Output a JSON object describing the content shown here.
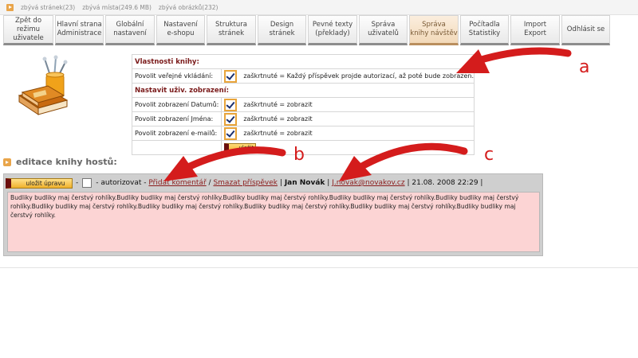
{
  "statusbar": {
    "items": [
      "zbývá stránek(23)",
      "zbývá místa(249.6 MB)",
      "zbývá obrázků(232)"
    ]
  },
  "nav": {
    "tabs": [
      {
        "label": "Zpět do režimu\nuživatele"
      },
      {
        "label": "Hlavní strana\nAdministrace"
      },
      {
        "label": "Globální\nnastavení"
      },
      {
        "label": "Nastavení\ne-shopu"
      },
      {
        "label": "Struktura\nstránek"
      },
      {
        "label": "Design\nstránek"
      },
      {
        "label": "Pevné texty\n(překlady)"
      },
      {
        "label": "Správa\nuživatelů"
      },
      {
        "label": "Správa\nknihy návštěv",
        "active": true
      },
      {
        "label": "Počítadla\nStatistiky"
      },
      {
        "label": "Import\nExport"
      },
      {
        "label": "Odhlásit se"
      }
    ]
  },
  "props": {
    "section_book": "Vlastnosti knihy:",
    "public_label": "Povolit veřejné vkládání:",
    "public_value": "zaškrtnuté = Každý příspěvek projde autorizací, až poté bude zobrazen.",
    "section_display": "Nastavit uživ. zobrazení:",
    "date_label": "Povolit zobrazení Datumů:",
    "date_value": "zaškrtnuté = zobrazit",
    "name_label": "Povolit zobrazení Jména:",
    "name_value": "zaškrtnuté = zobrazit",
    "email_label": "Povolit zobrazení e-mailů:",
    "email_value": "zaškrtnuté = zobrazit",
    "save_label": "uložit"
  },
  "section_title": "editace knihy hostů:",
  "entry": {
    "save_label": "uložit úpravu",
    "sep1": "-",
    "authorize_label": "- autorizovat -",
    "add_comment": "Přidat komentář",
    "slash": "/",
    "delete_post": "Smazat příspěvek",
    "pipe1": "|",
    "author": "Jan Novák",
    "pipe2": "|",
    "email": "J.novak@novakov.cz",
    "date": "| 21.08. 2008 22:29 |",
    "text": "Budliky budliky maj čerstvý rohlíky.Budliky budliky maj čerstvý rohlíky.Budliky budliky maj čerstvý rohlíky.Budliky budliky maj čerstvý rohlíky.Budliky budliky maj čerstvý rohlíky.Budliky budliky maj čerstvý rohlíky.Budliky budliky maj čerstvý rohlíky.Budliky budliky maj čerstvý rohlíky.Budliky budliky maj čerstvý rohlíky.Budliky budliky maj čerstvý rohlíky."
  },
  "annotations": {
    "a": "a",
    "b": "b",
    "c": "c",
    "color": "#d41c1c"
  }
}
